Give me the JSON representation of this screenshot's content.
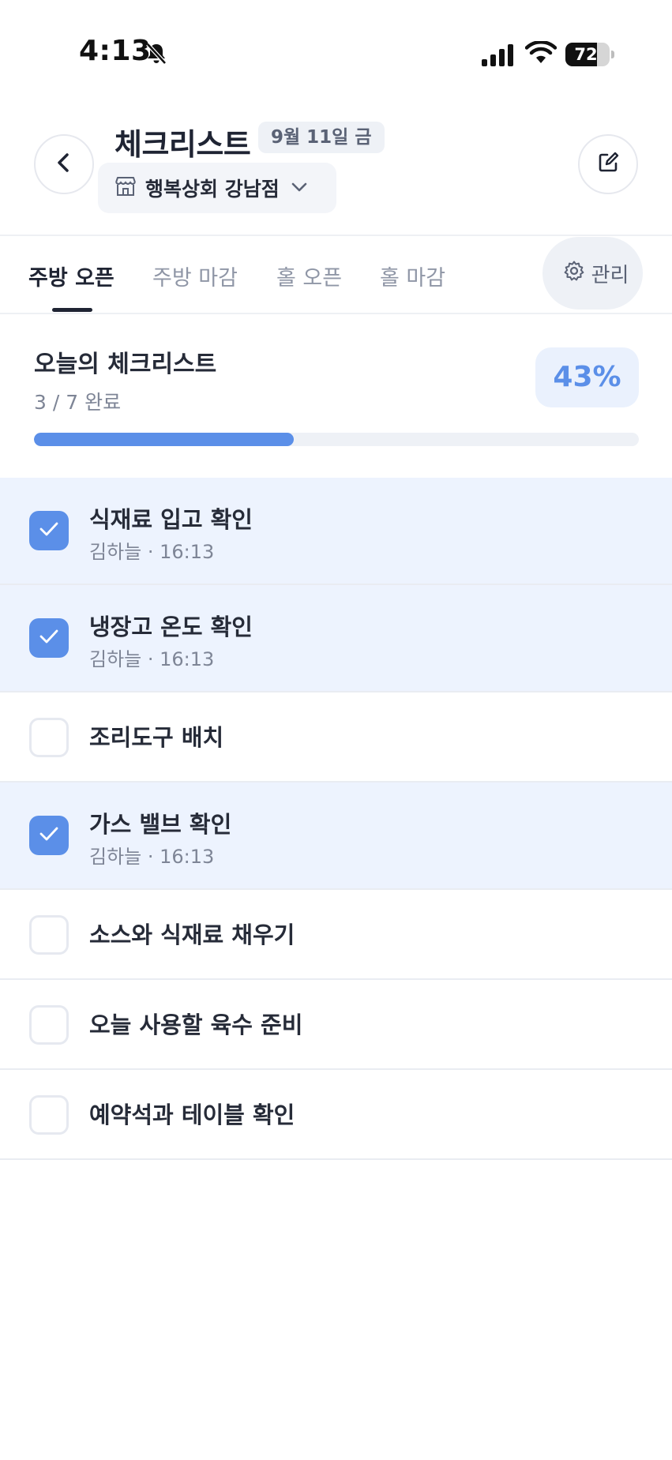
{
  "status_bar": {
    "time": "4:13",
    "battery": "72",
    "battery_level": 0.72
  },
  "header": {
    "title": "체크리스트",
    "date": "9월 11일 금",
    "store": "행복상회 강남점",
    "back_icon": "chevron-left-icon",
    "edit_icon": "edit-note-icon"
  },
  "tabs": [
    {
      "label": "주방 오픈",
      "active": true
    },
    {
      "label": "주방 마감",
      "active": false
    },
    {
      "label": "홀 오픈",
      "active": false
    },
    {
      "label": "홀 마감",
      "active": false
    }
  ],
  "manage": {
    "label": "관리",
    "icon": "gear-icon"
  },
  "summary": {
    "title": "오늘의 체크리스트",
    "count": "3 / 7 완료",
    "percent_label": "43%",
    "progress": 0.43
  },
  "items": [
    {
      "label": "식재료 입고 확인",
      "checked": true,
      "meta": "김하늘 · 16:13"
    },
    {
      "label": "냉장고 온도 확인",
      "checked": true,
      "meta": "김하늘 · 16:13"
    },
    {
      "label": "조리도구 배치",
      "checked": false,
      "meta": ""
    },
    {
      "label": "가스 밸브 확인",
      "checked": true,
      "meta": "김하늘 · 16:13"
    },
    {
      "label": "소스와 식재료 채우기",
      "checked": false,
      "meta": ""
    },
    {
      "label": "오늘 사용할 육수 준비",
      "checked": false,
      "meta": ""
    },
    {
      "label": "예약석과 테이블 확인",
      "checked": false,
      "meta": ""
    }
  ],
  "colors": {
    "accent": "#5b8fe8",
    "checked_row_bg": "#edf3fe",
    "text_primary": "#262b38",
    "text_secondary": "#7e8596"
  }
}
